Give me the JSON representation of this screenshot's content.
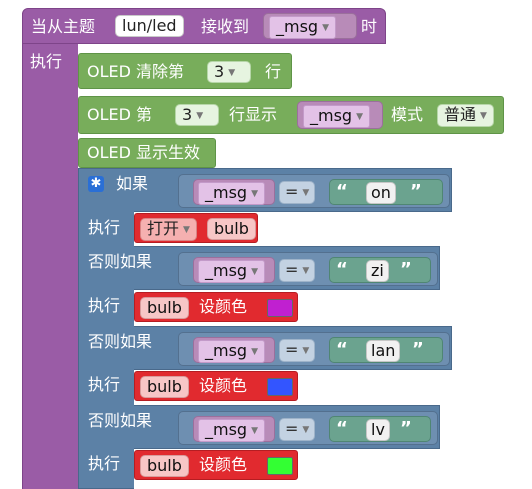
{
  "event": {
    "prefix": "当从主题",
    "topic": "lun/led",
    "received": "接收到",
    "var": "_msg",
    "suffix": "时",
    "do": "执行"
  },
  "oled_clear": {
    "prefix": "OLED 清除第",
    "num": "3",
    "suffix": "行"
  },
  "oled_show": {
    "prefix": "OLED 第",
    "num": "3",
    "mid": "行显示",
    "var": "_msg",
    "mode_label": "模式",
    "mode": "普通"
  },
  "oled_apply": {
    "label": "OLED 显示生效"
  },
  "if_block": {
    "if_label": "如果",
    "elseif_label": "否则如果",
    "do_label": "执行",
    "op": "=",
    "branches": [
      {
        "var": "_msg",
        "value": "on",
        "action": "打开",
        "target": "bulb"
      },
      {
        "var": "_msg",
        "value": "zi",
        "target": "bulb",
        "verb": "设颜色",
        "color": "#c020d0"
      },
      {
        "var": "_msg",
        "value": "lan",
        "target": "bulb",
        "verb": "设颜色",
        "color": "#3355ff"
      },
      {
        "var": "_msg",
        "value": "lv",
        "target": "bulb",
        "verb": "设颜色",
        "color": "#33ff33"
      }
    ]
  }
}
